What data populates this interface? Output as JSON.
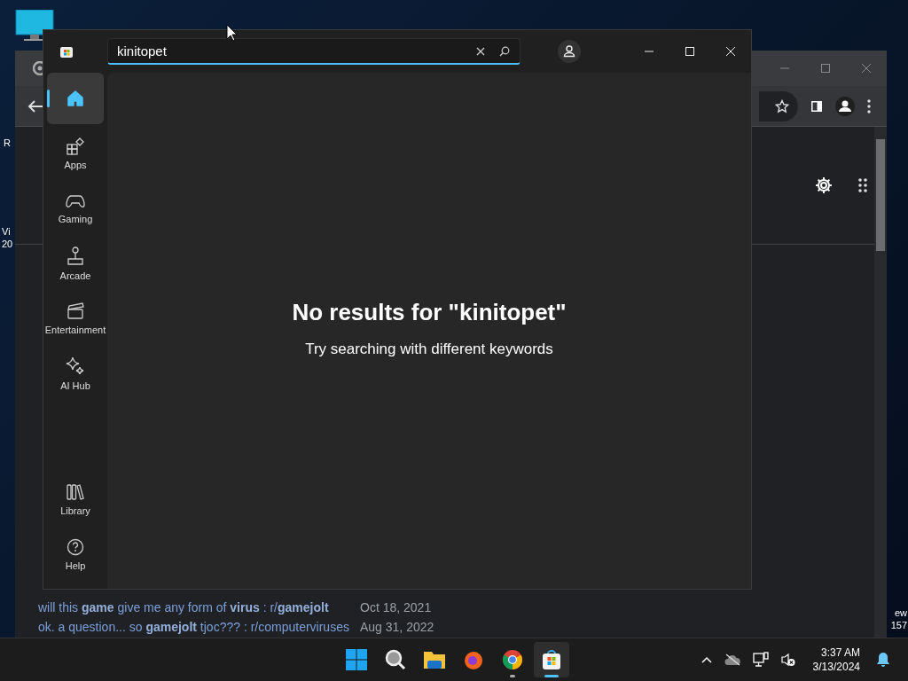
{
  "desktop": {
    "left_labels": [
      "R",
      "Vi",
      "20"
    ],
    "right_labels": [
      "ew",
      "157"
    ]
  },
  "browser": {
    "results": [
      {
        "title": "will this **game** give me any form of **virus** : r/**gamejolt**",
        "date": "Oct 18, 2021"
      },
      {
        "title": "ok. a question... so **gamejolt** tjoc??? : r/computerviruses",
        "date": "Aug 31, 2022"
      }
    ]
  },
  "store": {
    "search": {
      "value": "kinitopet"
    },
    "nav": [
      {
        "kind": "home",
        "selected": true
      },
      {
        "kind": "apps",
        "label": "Apps",
        "selected": false
      },
      {
        "kind": "gaming",
        "label": "Gaming",
        "selected": false
      },
      {
        "kind": "arcade",
        "label": "Arcade",
        "selected": false
      },
      {
        "kind": "entertainment",
        "label": "Entertainment",
        "selected": false
      },
      {
        "kind": "aihub",
        "label": "AI Hub",
        "selected": false
      },
      {
        "kind": "library",
        "label": "Library",
        "selected": false
      },
      {
        "kind": "help",
        "label": "Help",
        "selected": false
      }
    ],
    "message": {
      "title": "No results for \"kinitopet\"",
      "hint": "Try searching with different keywords"
    }
  },
  "taskbar": {
    "apps": [
      {
        "kind": "start",
        "running": false,
        "selected": false
      },
      {
        "kind": "search",
        "running": false,
        "selected": false
      },
      {
        "kind": "explorer",
        "running": false,
        "selected": false
      },
      {
        "kind": "firefox",
        "running": false,
        "selected": false
      },
      {
        "kind": "chrome",
        "running": true,
        "selected": false
      },
      {
        "kind": "store",
        "running": true,
        "selected": true
      }
    ],
    "time": "3:37 AM",
    "date": "3/13/2024"
  }
}
